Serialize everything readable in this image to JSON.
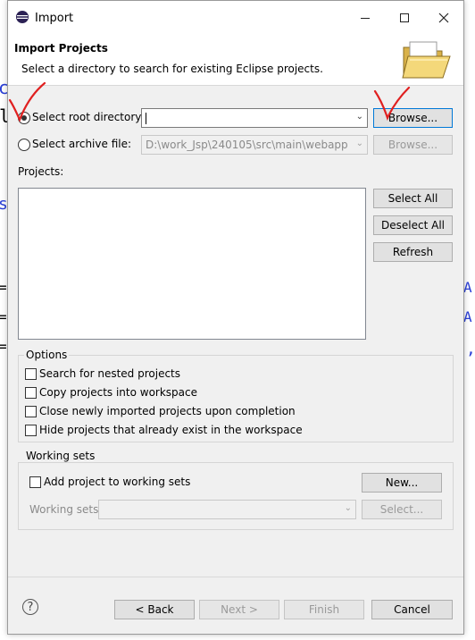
{
  "window": {
    "title": "Import"
  },
  "banner": {
    "title": "Import Projects",
    "description": "Select a directory to search for existing Eclipse projects."
  },
  "source": {
    "root_option_label": "Select root directory:",
    "root_value": "",
    "archive_option_label": "Select archive file:",
    "archive_value": "D:\\work_Jsp\\240105\\src\\main\\webapp",
    "browse_label": "Browse...",
    "selected": "root"
  },
  "projects": {
    "label": "Projects:",
    "select_all_label": "Select All",
    "deselect_all_label": "Deselect All",
    "refresh_label": "Refresh"
  },
  "options": {
    "title": "Options",
    "items": [
      {
        "label": "Search for nested projects",
        "checked": false
      },
      {
        "label": "Copy projects into workspace",
        "checked": false
      },
      {
        "label": "Close newly imported projects upon completion",
        "checked": false
      },
      {
        "label": "Hide projects that already exist in the workspace",
        "checked": false
      }
    ]
  },
  "working_sets": {
    "title": "Working sets",
    "add_label": "Add project to working sets",
    "new_label": "New...",
    "sets_label": "Working sets:",
    "select_label": "Select..."
  },
  "footer": {
    "back_label": "< Back",
    "next_label": "Next >",
    "finish_label": "Finish",
    "cancel_label": "Cancel"
  },
  "colors": {
    "annotation": "#e02020",
    "accent": "#0078d7",
    "background_code": "#2a3fd6"
  }
}
